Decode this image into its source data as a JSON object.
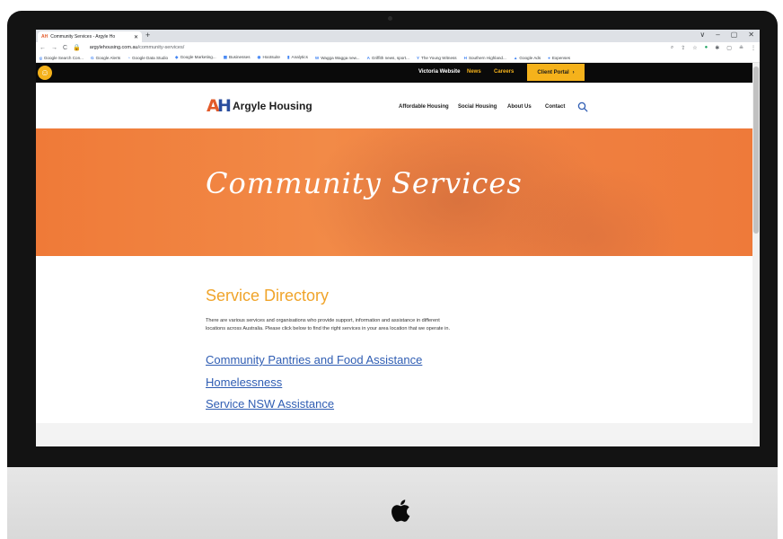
{
  "browser": {
    "tab_title": "Community Services - Argyle Ho",
    "tab_favicon": "AH",
    "tab_close": "✕",
    "new_tab": "+",
    "window_controls": [
      "∨",
      "–",
      "▢",
      "✕"
    ],
    "url_domain": "argylehousing.com.au",
    "url_path": "/community-services/",
    "bookmarks": [
      "Google Search Con...",
      "Google Alerts",
      "Google Data Studio",
      "Google Marketing...",
      "Businesses",
      "Hootsuite",
      "Analytics",
      "Wagga Wagga new...",
      "Griffith news, sport...",
      "The Young Witness",
      "Southern Highland...",
      "Google Ads",
      "Expenses"
    ]
  },
  "utility_bar": {
    "victoria": "Victoria Website",
    "news": "News",
    "careers": "Careers",
    "client_portal": "Client Portal",
    "portal_arrow": "›"
  },
  "header": {
    "logo_a": "A",
    "logo_h": "H",
    "logo_text": "Argyle Housing",
    "menu": [
      "Affordable Housing",
      "Social Housing",
      "About Us",
      "Contact"
    ]
  },
  "hero": {
    "title": "Community Services"
  },
  "main": {
    "heading": "Service Directory",
    "intro": "There are various services and organisations who provide support, information and assistance in different locations across Australia. Please click below to find the right services in your area location that we operate in.",
    "links": [
      "Community Pantries and Food Assistance",
      "Homelessness",
      "Service NSW Assistance"
    ]
  },
  "colors": {
    "accent_orange": "#ef7a38",
    "gold": "#f5b21b",
    "link_blue": "#2f5db3",
    "heading_gold": "#f0a42a"
  }
}
